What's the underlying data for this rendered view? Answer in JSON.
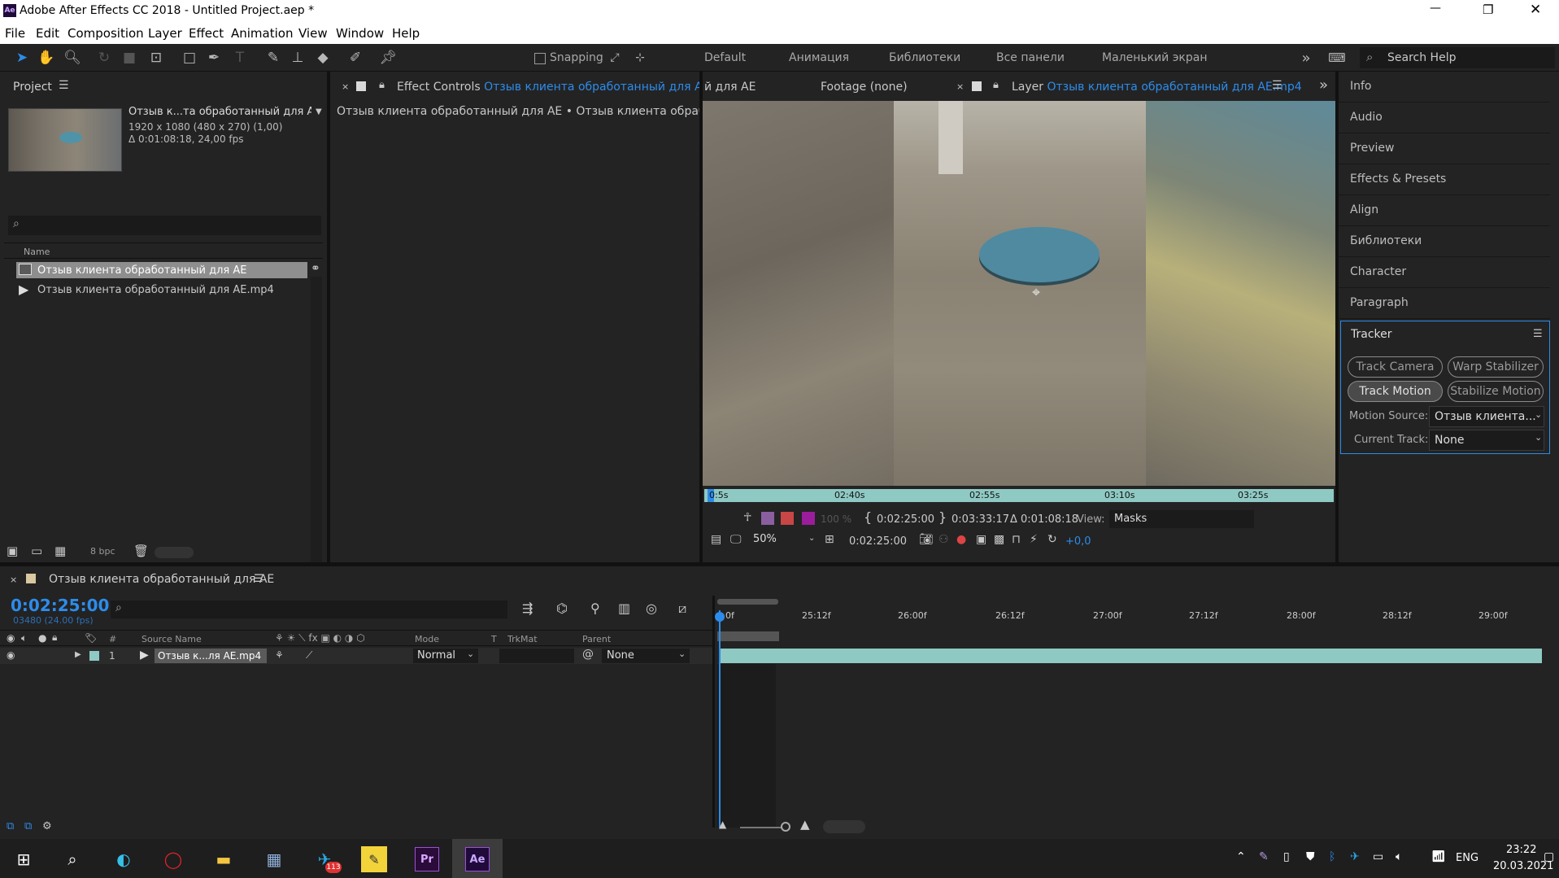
{
  "window": {
    "title": "Adobe After Effects CC 2018 - Untitled Project.aep *",
    "app_icon": "Ae",
    "controls": {
      "minimize": "—",
      "maximize": "❐",
      "close": "✕"
    }
  },
  "menu": [
    "File",
    "Edit",
    "Composition",
    "Layer",
    "Effect",
    "Animation",
    "View",
    "Window",
    "Help"
  ],
  "toolbar": {
    "snapping": "Snapping",
    "search_help": "Search Help"
  },
  "workspaces": [
    "Default",
    "Анимация",
    "Библиотеки",
    "Все панели",
    "Маленький экран"
  ],
  "project": {
    "title": "Project",
    "item_name": "Отзыв к...та обработанный для AE",
    "item_info1": "1920 x 1080 (480 x 270) (1,00)",
    "item_info2": "Δ 0:01:08:18, 24,00 fps",
    "column_name": "Name",
    "items": [
      {
        "name": "Отзыв клиента обработанный для AE",
        "icon": "composition-icon"
      },
      {
        "name": "Отзыв клиента обработанный для AE.mp4",
        "icon": "footage-icon"
      }
    ],
    "bpc": "8 bpc"
  },
  "effect_controls": {
    "tab_prefix": "Effect Controls",
    "tab_name": "Отзыв клиента обработанный для AE.mp",
    "breadcrumb": "Отзыв клиента обработанный для AE • Отзыв клиента обработанный"
  },
  "viewer": {
    "partial_tab": "й для AE",
    "footage_tab": "Footage (none)",
    "layer_prefix": "Layer",
    "layer_name": "Отзыв клиента обработанный для AE.mp4",
    "ruler": [
      "0:5s",
      "02:40s",
      "02:55s",
      "03:10s",
      "03:25s"
    ],
    "opacity": "100 %",
    "time_in": "0:02:25:00",
    "time_out": "0:03:33:17",
    "duration": "Δ 0:01:08:18",
    "view_label": "View:",
    "view_value": "Masks",
    "zoom": "50%",
    "current_time": "0:02:25:00",
    "exposure": "+0,0"
  },
  "right_panels": [
    "Info",
    "Audio",
    "Preview",
    "Effects & Presets",
    "Align",
    "Библиотеки",
    "Character",
    "Paragraph"
  ],
  "tracker": {
    "title": "Tracker",
    "buttons": [
      "Track Camera",
      "Warp Stabilizer",
      "Track Motion",
      "Stabilize Motion"
    ],
    "motion_source_label": "Motion Source:",
    "motion_source_value": "Отзыв клиента...",
    "current_track_label": "Current Track:",
    "current_track_value": "None"
  },
  "timeline": {
    "tab": "Отзыв клиента обработанный для AE",
    "timecode": "0:02:25:00",
    "frames": "03480 (24.00 fps)",
    "columns": {
      "num": "#",
      "source": "Source Name",
      "mode": "Mode",
      "t": "T",
      "trkmat": "TrkMat",
      "parent": "Parent"
    },
    "layer": {
      "num": "1",
      "name": "Отзыв к...ля AE.mp4",
      "mode": "Normal",
      "parent": "None"
    },
    "ruler": [
      "0f",
      "25:12f",
      "26:00f",
      "26:12f",
      "27:00f",
      "27:12f",
      "28:00f",
      "28:12f",
      "29:00f"
    ]
  },
  "taskbar": {
    "lang": "ENG",
    "time": "23:22",
    "date": "20.03.2021",
    "telegram_badge": "113",
    "pr": "Pr",
    "ae": "Ae"
  }
}
